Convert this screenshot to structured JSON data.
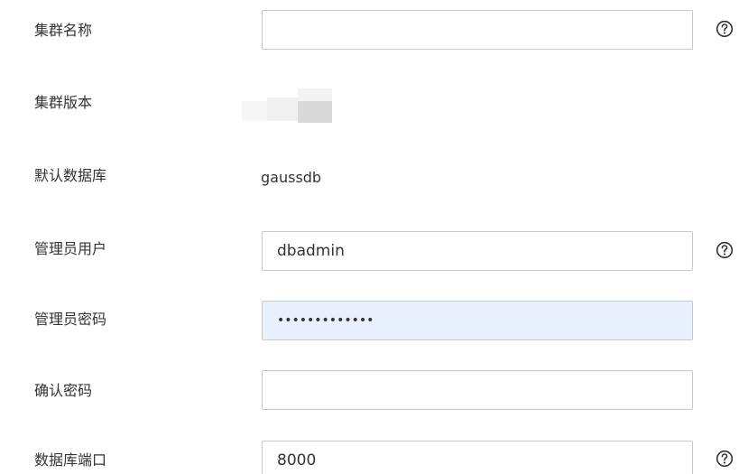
{
  "form": {
    "cluster_name": {
      "label": "集群名称",
      "value": "",
      "help_icon": "question-circle-icon"
    },
    "cluster_version": {
      "label": "集群版本",
      "value_obscured": true
    },
    "default_database": {
      "label": "默认数据库",
      "value": "gaussdb"
    },
    "admin_user": {
      "label": "管理员用户",
      "value": "dbadmin",
      "help_icon": "question-circle-icon"
    },
    "admin_password": {
      "label": "管理员密码",
      "value": "•••••••••••••",
      "autofilled": true
    },
    "confirm_password": {
      "label": "确认密码",
      "value": ""
    },
    "db_port": {
      "label": "数据库端口",
      "value": "8000",
      "help_icon": "question-circle-icon"
    }
  },
  "colors": {
    "label_text": "#333333",
    "input_border": "#c8c8c8",
    "autofill_background": "#e8f0fe",
    "help_icon": "#333333"
  }
}
